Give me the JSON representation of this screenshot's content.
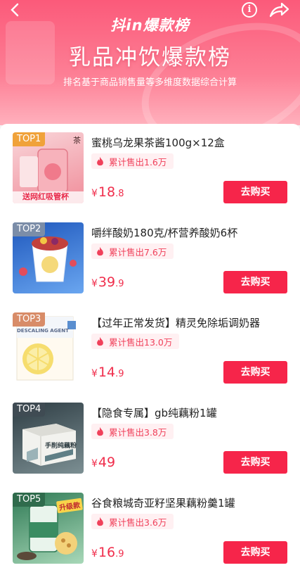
{
  "header": {
    "logo": "抖in爆款榜",
    "title": "乳品冲饮爆款榜",
    "subtitle": "排名基于商品销售量等多维度数据综合计算",
    "colors": {
      "top": "#fb5a7a",
      "bottom": "#ffb1bd"
    }
  },
  "topbar": {
    "back_icon": "chevron-left",
    "info_icon": "info",
    "share_icon": "share-arrow",
    "info_glyph": "i"
  },
  "accent_colors": {
    "price": "#f02e4c",
    "button": "#f6254a",
    "sold_bg": "#fff0f2"
  },
  "items": [
    {
      "rank": "TOP1",
      "name": "蜜桃乌龙果茶酱100g×12盒",
      "sold": "累计售出1.6万",
      "price_yen": "¥",
      "price_int": "18",
      "price_dec": ".8",
      "button": "去购买",
      "thumb_text": "送网红吸管杯",
      "thumb_tag": "茶",
      "thumb_colors": [
        "#f6c2c8",
        "#f08d9a"
      ]
    },
    {
      "rank": "TOP2",
      "name": "嚼绊酸奶180克/杯营养酸奶6杯",
      "sold": "累计售出7.6万",
      "price_yen": "¥",
      "price_int": "39",
      "price_dec": ".9",
      "button": "去购买",
      "thumb_text": "",
      "thumb_tag": "",
      "thumb_colors": [
        "#2a65c9",
        "#6aa6f0"
      ]
    },
    {
      "rank": "TOP3",
      "name": "【过年正常发货】精灵免除垢调奶器",
      "sold": "累计售出13.0万",
      "price_yen": "¥",
      "price_int": "14",
      "price_dec": ".9",
      "button": "去购买",
      "thumb_text": "DESCALING AGENT",
      "thumb_tag": "",
      "thumb_colors": [
        "#ffffff",
        "#f7e39a"
      ]
    },
    {
      "rank": "TOP4",
      "name": "【隐食专属】gb纯藕粉1罐",
      "sold": "累计售出3.8万",
      "price_yen": "¥",
      "price_int": "49",
      "price_dec": "",
      "button": "去购买",
      "thumb_text": "手削纯藕粉",
      "thumb_tag": "",
      "thumb_colors": [
        "#3c4b52",
        "#7c8f93"
      ]
    },
    {
      "rank": "TOP5",
      "name": "谷食粮城奇亚籽坚果藕粉羹1罐",
      "sold": "累计售出3.6万",
      "price_yen": "¥",
      "price_int": "16",
      "price_dec": ".9",
      "button": "去购买",
      "thumb_text": "升级款",
      "thumb_tag": "",
      "thumb_colors": [
        "#2f7a55",
        "#a8d8b8"
      ]
    }
  ]
}
